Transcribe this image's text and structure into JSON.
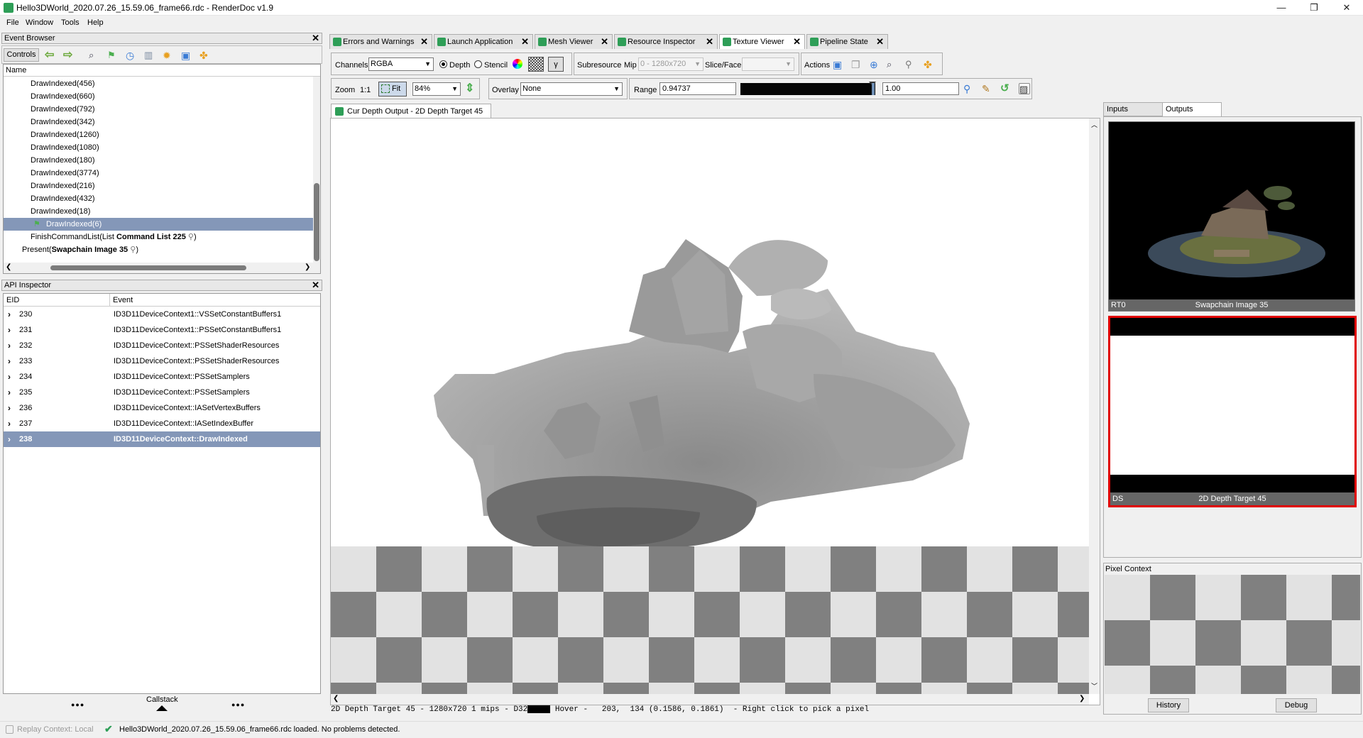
{
  "window": {
    "title": "Hello3DWorld_2020.07.26_15.59.06_frame66.rdc - RenderDoc v1.9",
    "minimize": "—",
    "maximize": "❐",
    "close": "✕"
  },
  "menu": [
    "File",
    "Window",
    "Tools",
    "Help"
  ],
  "event_browser": {
    "title": "Event Browser",
    "controls_label": "Controls",
    "column_name": "Name",
    "rows": [
      "DrawIndexed(456)",
      "DrawIndexed(660)",
      "DrawIndexed(792)",
      "DrawIndexed(342)",
      "DrawIndexed(1260)",
      "DrawIndexed(1080)",
      "DrawIndexed(180)",
      "DrawIndexed(3774)",
      "DrawIndexed(216)",
      "DrawIndexed(432)",
      "DrawIndexed(18)"
    ],
    "selected_row": "DrawIndexed(6)",
    "finish_prefix": "FinishCommandList(List ",
    "finish_bold": "Command List 225",
    "finish_suffix": ")",
    "present_prefix": "Present(",
    "present_bold": "Swapchain Image 35",
    "present_suffix": ")"
  },
  "api_inspector": {
    "title": "API Inspector",
    "col_eid": "EID",
    "col_event": "Event",
    "rows": [
      {
        "eid": "230",
        "event": "ID3D11DeviceContext1::VSSetConstantBuffers1"
      },
      {
        "eid": "231",
        "event": "ID3D11DeviceContext1::PSSetConstantBuffers1"
      },
      {
        "eid": "232",
        "event": "ID3D11DeviceContext::PSSetShaderResources"
      },
      {
        "eid": "233",
        "event": "ID3D11DeviceContext::PSSetShaderResources"
      },
      {
        "eid": "234",
        "event": "ID3D11DeviceContext::PSSetSamplers"
      },
      {
        "eid": "235",
        "event": "ID3D11DeviceContext::PSSetSamplers"
      },
      {
        "eid": "236",
        "event": "ID3D11DeviceContext::IASetVertexBuffers"
      },
      {
        "eid": "237",
        "event": "ID3D11DeviceContext::IASetIndexBuffer"
      },
      {
        "eid": "238",
        "event": "ID3D11DeviceContext::DrawIndexed"
      }
    ],
    "callstack": "Callstack",
    "dots": "●●●"
  },
  "tabs": [
    "Errors and Warnings",
    "Launch Application",
    "Mesh Viewer",
    "Resource Inspector",
    "Texture Viewer",
    "Pipeline State"
  ],
  "toolbar": {
    "channels_label": "Channels",
    "channels_value": "RGBA",
    "depth_label": "Depth",
    "stencil_label": "Stencil",
    "gamma_label": "γ",
    "subresource_label": "Subresource",
    "mip_label": "Mip",
    "mip_value": "0 - 1280x720",
    "slice_label": "Slice/Face",
    "slice_value": "",
    "actions_label": "Actions",
    "zoom_label": "Zoom",
    "zoom_1to1": "1:1",
    "fit_label": "Fit",
    "zoom_value": "84%",
    "overlay_label": "Overlay",
    "overlay_value": "None",
    "range_label": "Range",
    "range_min": "0.94737",
    "range_max": "1.00"
  },
  "texture_tab": "Cur Depth Output - 2D Depth Target 45",
  "status_line": "2D Depth Target 45 - 1280x720 1 mips - D32",
  "hover_line": "Hover -   203,  134 (0.1586, 0.1861)  - Right click to pick a pixel",
  "side_tabs": {
    "inputs": "Inputs",
    "outputs": "Outputs"
  },
  "thumbnails": [
    {
      "slot": "RT0",
      "name": "Swapchain Image 35"
    },
    {
      "slot": "DS",
      "name": "2D Depth Target 45"
    }
  ],
  "pixel_context": {
    "title": "Pixel Context",
    "history": "History",
    "debug": "Debug"
  },
  "statusbar": {
    "replay": "Replay Context: Local",
    "message": "Hello3DWorld_2020.07.26_15.59.06_frame66.rdc loaded. No problems detected."
  },
  "colors": {
    "selection": "#8497b8",
    "accent_green": "#2e9e57",
    "highlight_border": "#e00000"
  }
}
